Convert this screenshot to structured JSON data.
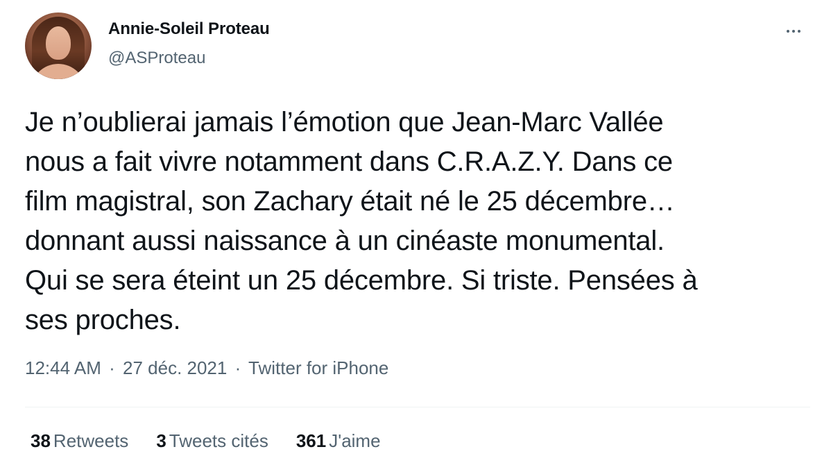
{
  "author": {
    "display_name": "Annie-Soleil Proteau",
    "handle": "@ASProteau"
  },
  "more_icon": "more-horizontal-icon",
  "tweet": {
    "text": "Je n’oublierai jamais l’émotion que Jean-Marc Vallée\nnous a fait vivre notamment dans C.R.A.Z.Y. Dans ce\nfilm magistral, son Zachary était né le 25 décembre…\ndonnant aussi naissance à un cinéaste monumental.\nQui se sera éteint un 25 décembre. Si triste. Pensées à\nses proches."
  },
  "meta": {
    "time": "12:44 AM",
    "date": "27 déc. 2021",
    "separator": "·",
    "source": "Twitter for iPhone"
  },
  "stats": {
    "retweets_count": "38",
    "retweets_label": "Retweets",
    "quotes_count": "3",
    "quotes_label": "Tweets cités",
    "likes_count": "361",
    "likes_label": "J'aime"
  },
  "colors": {
    "text_primary": "#0f1419",
    "text_secondary": "#536471",
    "divider": "#eff3f4"
  }
}
